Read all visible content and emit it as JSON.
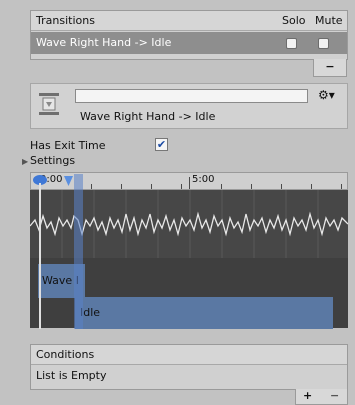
{
  "transitions": {
    "title": "Transitions",
    "solo_label": "Solo",
    "mute_label": "Mute",
    "rows": [
      {
        "label": "Wave Right Hand -> Idle",
        "solo": false,
        "mute": false
      }
    ],
    "minus_label": "−"
  },
  "inspector": {
    "name_value": "",
    "subtitle": "Wave Right Hand -> Idle",
    "gear_icon": "gear-icon"
  },
  "has_exit_time": {
    "label": "Has Exit Time",
    "checked": true,
    "check_glyph": "✔"
  },
  "settings": {
    "label": "Settings"
  },
  "timeline": {
    "ruler_labels": [
      "0:00",
      "5:00"
    ],
    "clips": [
      {
        "label": "Wave I"
      },
      {
        "label": "Idle"
      }
    ],
    "colors": {
      "clip": "#5a78a3",
      "wave_bg": "#474747",
      "track_bg": "#3f3f3f"
    }
  },
  "conditions": {
    "title": "Conditions",
    "empty_text": "List is Empty",
    "plus_label": "+",
    "minus_label": "−"
  }
}
